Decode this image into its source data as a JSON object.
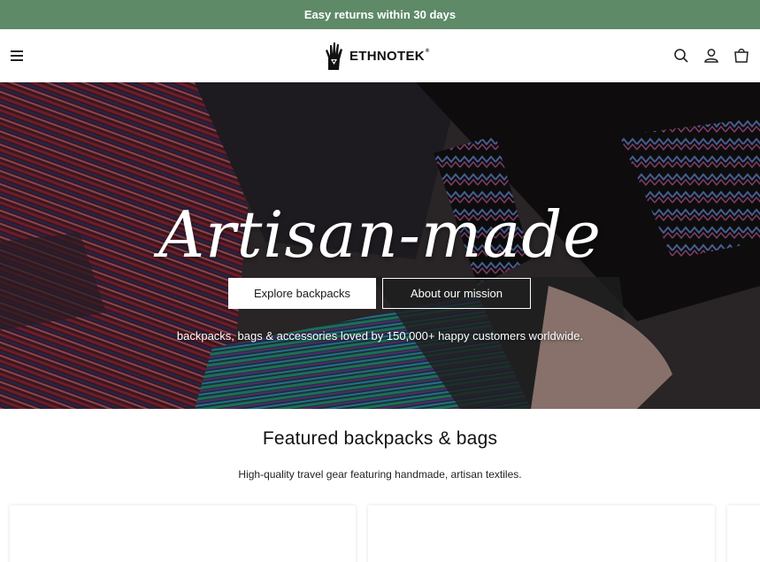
{
  "announcement": {
    "text": "Easy returns within 30 days",
    "bg_color": "#5e8a67"
  },
  "header": {
    "logo_text": "ETHNOTEK",
    "logo_mark": "®",
    "icons": [
      "menu-icon",
      "search-icon",
      "account-icon",
      "cart-icon"
    ]
  },
  "hero": {
    "title": "Artisan-made",
    "subtitle": "backpacks, bags & accessories loved by 150,000+ happy customers worldwide.",
    "primary_button": "Explore backpacks",
    "secondary_button": "About our mission"
  },
  "featured": {
    "title": "Featured backpacks & bags",
    "subtitle": "High-quality travel gear featuring handmade, artisan textiles."
  }
}
